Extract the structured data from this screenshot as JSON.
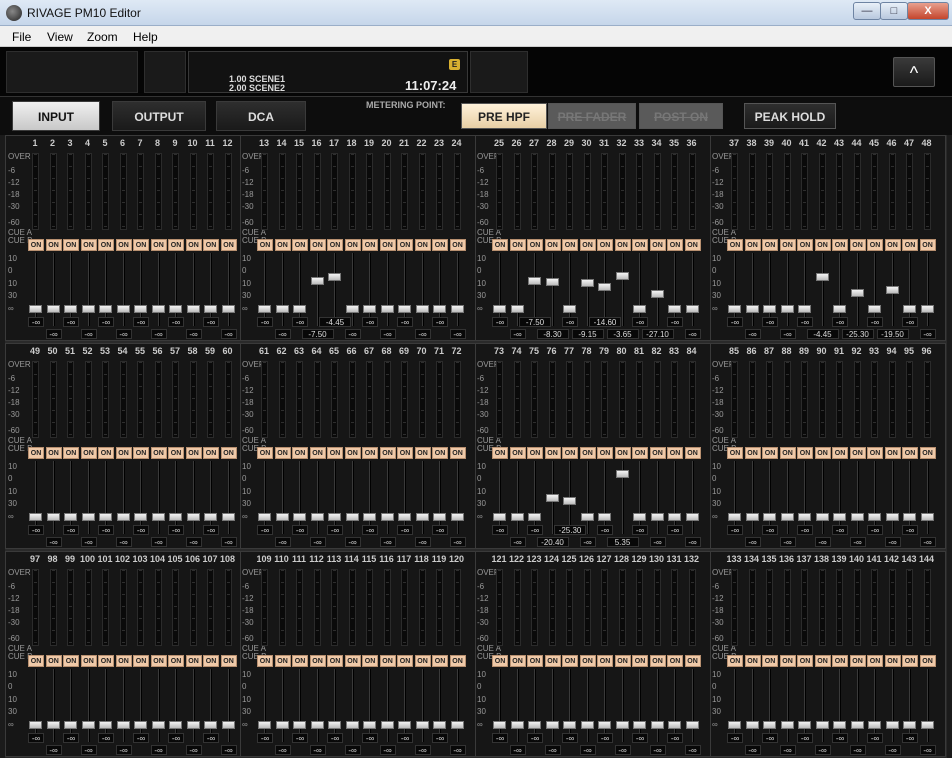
{
  "app": {
    "title": "RIVAGE PM10 Editor"
  },
  "window_buttons": {
    "minimize": "—",
    "maximize": "□",
    "close": "X"
  },
  "menu": [
    "File",
    "View",
    "Zoom",
    "Help"
  ],
  "scene": {
    "line1": "1.00 SCENE1",
    "line2": "2.00 SCENE2",
    "time": "11:07:24",
    "badge": "E"
  },
  "collapse_symbol": "^",
  "tabs": [
    "INPUT",
    "OUTPUT",
    "DCA"
  ],
  "metering": {
    "label": "METERING POINT:",
    "buttons": [
      "PRE HPF",
      "PRE FADER",
      "POST ON"
    ],
    "peak_hold": "PEAK HOLD",
    "selected": "PRE HPF"
  },
  "meter_scale": [
    "OVER",
    "-6",
    "-12",
    "-18",
    "-30",
    "-60",
    "CUE A",
    "CUE B"
  ],
  "fader_scale": [
    "10",
    "0",
    "10",
    "30",
    "∞"
  ],
  "on_label": "ON",
  "inf_label": "-∞",
  "channels": [
    {
      "n": 1,
      "fader": "-∞"
    },
    {
      "n": 2,
      "fader": "-∞"
    },
    {
      "n": 3,
      "fader": "-∞"
    },
    {
      "n": 4,
      "fader": "-∞"
    },
    {
      "n": 5,
      "fader": "-∞"
    },
    {
      "n": 6,
      "fader": "-∞"
    },
    {
      "n": 7,
      "fader": "-∞"
    },
    {
      "n": 8,
      "fader": "-∞"
    },
    {
      "n": 9,
      "fader": "-∞"
    },
    {
      "n": 10,
      "fader": "-∞"
    },
    {
      "n": 11,
      "fader": "-∞"
    },
    {
      "n": 12,
      "fader": "-∞"
    },
    {
      "n": 13,
      "fader": "-∞"
    },
    {
      "n": 14,
      "fader": "-∞"
    },
    {
      "n": 15,
      "fader": "-∞"
    },
    {
      "n": 16,
      "fader": "-7.50"
    },
    {
      "n": 17,
      "fader": "-4.45"
    },
    {
      "n": 18,
      "fader": "-∞"
    },
    {
      "n": 19,
      "fader": "-∞"
    },
    {
      "n": 20,
      "fader": "-∞"
    },
    {
      "n": 21,
      "fader": "-∞"
    },
    {
      "n": 22,
      "fader": "-∞"
    },
    {
      "n": 23,
      "fader": "-∞"
    },
    {
      "n": 24,
      "fader": "-∞"
    },
    {
      "n": 25,
      "fader": "-∞"
    },
    {
      "n": 26,
      "fader": "-∞"
    },
    {
      "n": 27,
      "fader": "-7.50"
    },
    {
      "n": 28,
      "fader": "-8.30"
    },
    {
      "n": 29,
      "fader": "-∞"
    },
    {
      "n": 30,
      "fader": "-9.15"
    },
    {
      "n": 31,
      "fader": "-14.60"
    },
    {
      "n": 32,
      "fader": "-3.65"
    },
    {
      "n": 33,
      "fader": "-∞"
    },
    {
      "n": 34,
      "fader": "-27.10"
    },
    {
      "n": 35,
      "fader": "-∞"
    },
    {
      "n": 36,
      "fader": "-∞"
    },
    {
      "n": 37,
      "fader": "-∞"
    },
    {
      "n": 38,
      "fader": "-∞"
    },
    {
      "n": 39,
      "fader": "-∞"
    },
    {
      "n": 40,
      "fader": "-∞"
    },
    {
      "n": 41,
      "fader": "-∞"
    },
    {
      "n": 42,
      "fader": "-4.45"
    },
    {
      "n": 43,
      "fader": "-∞"
    },
    {
      "n": 44,
      "fader": "-25.30"
    },
    {
      "n": 45,
      "fader": "-∞"
    },
    {
      "n": 46,
      "fader": "-19.50"
    },
    {
      "n": 47,
      "fader": "-∞"
    },
    {
      "n": 48,
      "fader": "-∞"
    },
    {
      "n": 49,
      "fader": "-∞"
    },
    {
      "n": 50,
      "fader": "-∞"
    },
    {
      "n": 51,
      "fader": "-∞"
    },
    {
      "n": 52,
      "fader": "-∞"
    },
    {
      "n": 53,
      "fader": "-∞"
    },
    {
      "n": 54,
      "fader": "-∞"
    },
    {
      "n": 55,
      "fader": "-∞"
    },
    {
      "n": 56,
      "fader": "-∞"
    },
    {
      "n": 57,
      "fader": "-∞"
    },
    {
      "n": 58,
      "fader": "-∞"
    },
    {
      "n": 59,
      "fader": "-∞"
    },
    {
      "n": 60,
      "fader": "-∞"
    },
    {
      "n": 61,
      "fader": "-∞"
    },
    {
      "n": 62,
      "fader": "-∞"
    },
    {
      "n": 63,
      "fader": "-∞"
    },
    {
      "n": 64,
      "fader": "-∞"
    },
    {
      "n": 65,
      "fader": "-∞"
    },
    {
      "n": 66,
      "fader": "-∞"
    },
    {
      "n": 67,
      "fader": "-∞"
    },
    {
      "n": 68,
      "fader": "-∞"
    },
    {
      "n": 69,
      "fader": "-∞"
    },
    {
      "n": 70,
      "fader": "-∞"
    },
    {
      "n": 71,
      "fader": "-∞"
    },
    {
      "n": 72,
      "fader": "-∞"
    },
    {
      "n": 73,
      "fader": "-∞"
    },
    {
      "n": 74,
      "fader": "-∞"
    },
    {
      "n": 75,
      "fader": "-∞"
    },
    {
      "n": 76,
      "fader": "-20.40"
    },
    {
      "n": 77,
      "fader": "-25.30"
    },
    {
      "n": 78,
      "fader": "-∞"
    },
    {
      "n": 79,
      "fader": "-∞"
    },
    {
      "n": 80,
      "fader": "5.35"
    },
    {
      "n": 81,
      "fader": "-∞"
    },
    {
      "n": 82,
      "fader": "-∞"
    },
    {
      "n": 83,
      "fader": "-∞"
    },
    {
      "n": 84,
      "fader": "-∞"
    },
    {
      "n": 85,
      "fader": "-∞"
    },
    {
      "n": 86,
      "fader": "-∞"
    },
    {
      "n": 87,
      "fader": "-∞"
    },
    {
      "n": 88,
      "fader": "-∞"
    },
    {
      "n": 89,
      "fader": "-∞"
    },
    {
      "n": 90,
      "fader": "-∞"
    },
    {
      "n": 91,
      "fader": "-∞"
    },
    {
      "n": 92,
      "fader": "-∞"
    },
    {
      "n": 93,
      "fader": "-∞"
    },
    {
      "n": 94,
      "fader": "-∞"
    },
    {
      "n": 95,
      "fader": "-∞"
    },
    {
      "n": 96,
      "fader": "-∞"
    },
    {
      "n": 97,
      "fader": "-∞"
    },
    {
      "n": 98,
      "fader": "-∞"
    },
    {
      "n": 99,
      "fader": "-∞"
    },
    {
      "n": 100,
      "fader": "-∞"
    },
    {
      "n": 101,
      "fader": "-∞"
    },
    {
      "n": 102,
      "fader": "-∞"
    },
    {
      "n": 103,
      "fader": "-∞"
    },
    {
      "n": 104,
      "fader": "-∞"
    },
    {
      "n": 105,
      "fader": "-∞"
    },
    {
      "n": 106,
      "fader": "-∞"
    },
    {
      "n": 107,
      "fader": "-∞"
    },
    {
      "n": 108,
      "fader": "-∞"
    },
    {
      "n": 109,
      "fader": "-∞"
    },
    {
      "n": 110,
      "fader": "-∞"
    },
    {
      "n": 111,
      "fader": "-∞"
    },
    {
      "n": 112,
      "fader": "-∞"
    },
    {
      "n": 113,
      "fader": "-∞"
    },
    {
      "n": 114,
      "fader": "-∞"
    },
    {
      "n": 115,
      "fader": "-∞"
    },
    {
      "n": 116,
      "fader": "-∞"
    },
    {
      "n": 117,
      "fader": "-∞"
    },
    {
      "n": 118,
      "fader": "-∞"
    },
    {
      "n": 119,
      "fader": "-∞"
    },
    {
      "n": 120,
      "fader": "-∞"
    },
    {
      "n": 121,
      "fader": "-∞"
    },
    {
      "n": 122,
      "fader": "-∞"
    },
    {
      "n": 123,
      "fader": "-∞"
    },
    {
      "n": 124,
      "fader": "-∞"
    },
    {
      "n": 125,
      "fader": "-∞"
    },
    {
      "n": 126,
      "fader": "-∞"
    },
    {
      "n": 127,
      "fader": "-∞"
    },
    {
      "n": 128,
      "fader": "-∞"
    },
    {
      "n": 129,
      "fader": "-∞"
    },
    {
      "n": 130,
      "fader": "-∞"
    },
    {
      "n": 131,
      "fader": "-∞"
    },
    {
      "n": 132,
      "fader": "-∞"
    },
    {
      "n": 133,
      "fader": "-∞"
    },
    {
      "n": 134,
      "fader": "-∞"
    },
    {
      "n": 135,
      "fader": "-∞"
    },
    {
      "n": 136,
      "fader": "-∞"
    },
    {
      "n": 137,
      "fader": "-∞"
    },
    {
      "n": 138,
      "fader": "-∞"
    },
    {
      "n": 139,
      "fader": "-∞"
    },
    {
      "n": 140,
      "fader": "-∞"
    },
    {
      "n": 141,
      "fader": "-∞"
    },
    {
      "n": 142,
      "fader": "-∞"
    },
    {
      "n": 143,
      "fader": "-∞"
    },
    {
      "n": 144,
      "fader": "-∞"
    }
  ]
}
